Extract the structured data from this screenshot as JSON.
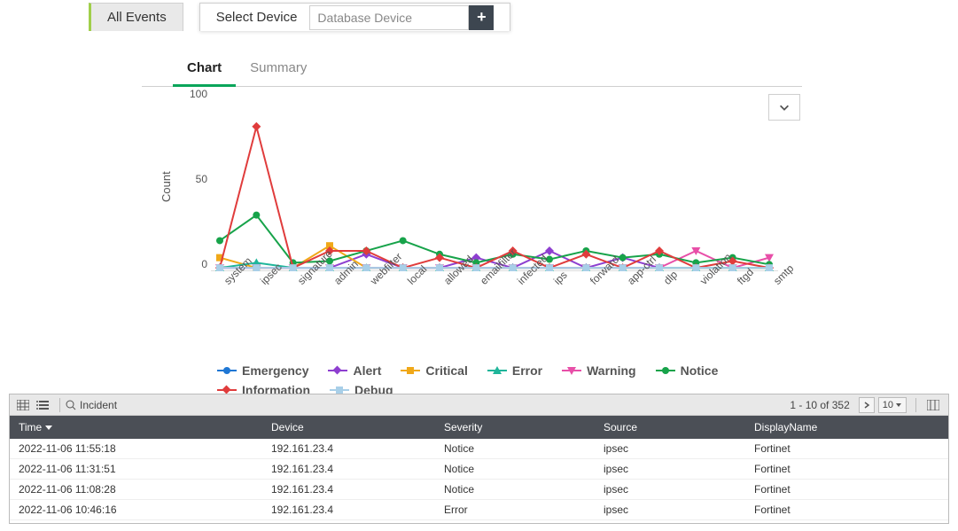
{
  "tabs": {
    "all": "All Events",
    "device_label": "Select Device",
    "device_placeholder": "Database Device"
  },
  "subtabs": {
    "chart": "Chart",
    "summary": "Summary"
  },
  "chart_data": {
    "type": "line",
    "ylabel": "Count",
    "ylim": [
      0,
      100
    ],
    "yticks": [
      0,
      50,
      100
    ],
    "categories": [
      "system",
      "ipsec",
      "signature",
      "admin",
      "webfilter",
      "local",
      "allowed",
      "emailfilter",
      "infected",
      "ips",
      "forward",
      "app-ctrl",
      "dlp",
      "violation",
      "ftgd",
      "smtp"
    ],
    "series": [
      {
        "name": "Emergency",
        "color": "#1f77d4",
        "marker": "circle",
        "values": [
          2,
          2,
          2,
          2,
          2,
          2,
          2,
          2,
          2,
          2,
          2,
          2,
          2,
          2,
          2,
          2
        ]
      },
      {
        "name": "Alert",
        "color": "#8e3fd0",
        "marker": "diamond",
        "values": [
          2,
          2,
          2,
          2,
          10,
          2,
          2,
          8,
          2,
          12,
          2,
          8,
          2,
          2,
          2,
          2
        ]
      },
      {
        "name": "Critical",
        "color": "#f0a818",
        "marker": "square",
        "values": [
          8,
          2,
          2,
          15,
          2,
          2,
          2,
          2,
          2,
          2,
          2,
          2,
          2,
          2,
          2,
          2
        ]
      },
      {
        "name": "Error",
        "color": "#1fb59a",
        "marker": "triangle",
        "values": [
          2,
          5,
          2,
          2,
          2,
          2,
          2,
          2,
          2,
          2,
          2,
          2,
          2,
          2,
          2,
          2
        ]
      },
      {
        "name": "Warning",
        "color": "#e84fa8",
        "marker": "tridown",
        "values": [
          2,
          2,
          2,
          2,
          2,
          2,
          2,
          2,
          2,
          2,
          2,
          2,
          2,
          12,
          2,
          8
        ]
      },
      {
        "name": "Notice",
        "color": "#17a34a",
        "marker": "circle",
        "values": [
          18,
          33,
          5,
          6,
          12,
          18,
          10,
          5,
          10,
          7,
          12,
          8,
          10,
          5,
          8,
          4
        ]
      },
      {
        "name": "Information",
        "color": "#e03c3c",
        "marker": "diamond",
        "values": [
          2,
          85,
          2,
          12,
          12,
          2,
          8,
          2,
          12,
          2,
          10,
          2,
          12,
          2,
          6,
          2
        ]
      },
      {
        "name": "Debug",
        "color": "#a8cfe8",
        "marker": "square",
        "values": [
          2,
          2,
          2,
          2,
          2,
          2,
          2,
          2,
          2,
          2,
          2,
          2,
          2,
          2,
          2,
          2
        ]
      }
    ]
  },
  "toolbar": {
    "incident": "Incident",
    "pager": "1 - 10 of 352",
    "pagesize": "10"
  },
  "table": {
    "columns": {
      "time": "Time",
      "device": "Device",
      "severity": "Severity",
      "source": "Source",
      "display": "DisplayName"
    },
    "rows": [
      {
        "time": "2022-11-06 11:55:18",
        "device": "192.161.23.4",
        "severity": "Notice",
        "source": "ipsec",
        "display": "Fortinet"
      },
      {
        "time": "2022-11-06 11:31:51",
        "device": "192.161.23.4",
        "severity": "Notice",
        "source": "ipsec",
        "display": "Fortinet"
      },
      {
        "time": "2022-11-06 11:08:28",
        "device": "192.161.23.4",
        "severity": "Notice",
        "source": "ipsec",
        "display": "Fortinet"
      },
      {
        "time": "2022-11-06 10:46:16",
        "device": "192.161.23.4",
        "severity": "Error",
        "source": "ipsec",
        "display": "Fortinet"
      }
    ]
  }
}
